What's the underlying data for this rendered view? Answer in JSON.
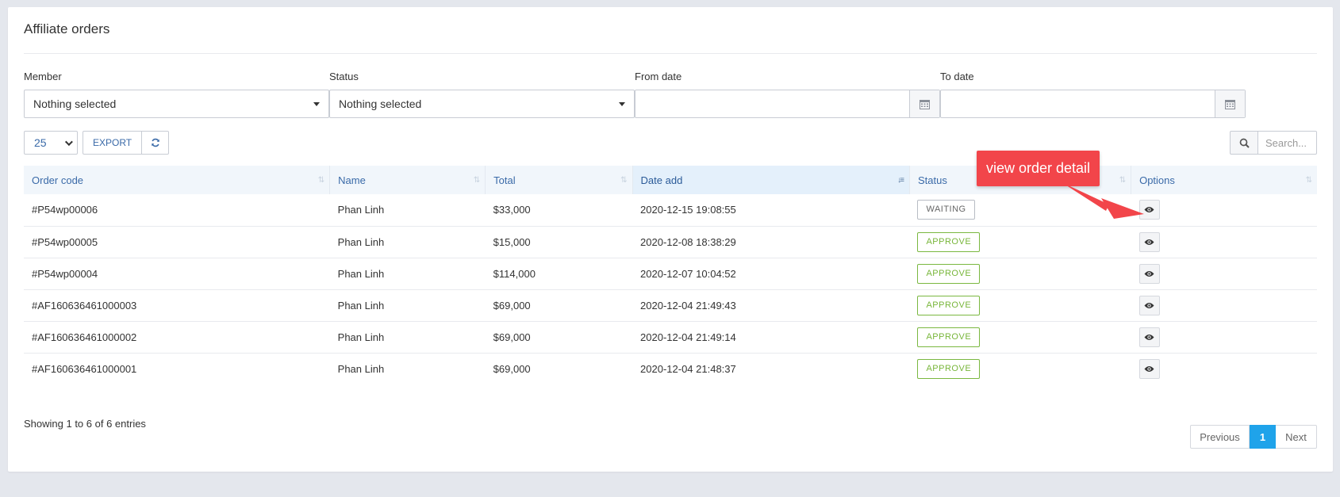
{
  "page": {
    "title": "Affiliate orders"
  },
  "filters": {
    "member": {
      "label": "Member",
      "value": "Nothing selected"
    },
    "status": {
      "label": "Status",
      "value": "Nothing selected"
    },
    "from_date": {
      "label": "From date",
      "value": ""
    },
    "to_date": {
      "label": "To date",
      "value": ""
    }
  },
  "toolbar": {
    "page_length": "25",
    "export_label": "EXPORT"
  },
  "search": {
    "placeholder": "Search..."
  },
  "table": {
    "columns": [
      "Order code",
      "Name",
      "Total",
      "Date add",
      "Status",
      "Options"
    ],
    "rows": [
      {
        "code": "#P54wp00006",
        "name": "Phan Linh",
        "total": "$33,000",
        "date": "2020-12-15 19:08:55",
        "status": "WAITING"
      },
      {
        "code": "#P54wp00005",
        "name": "Phan Linh",
        "total": "$15,000",
        "date": "2020-12-08 18:38:29",
        "status": "APPROVE"
      },
      {
        "code": "#P54wp00004",
        "name": "Phan Linh",
        "total": "$114,000",
        "date": "2020-12-07 10:04:52",
        "status": "APPROVE"
      },
      {
        "code": "#AF160636461000003",
        "name": "Phan Linh",
        "total": "$69,000",
        "date": "2020-12-04 21:49:43",
        "status": "APPROVE"
      },
      {
        "code": "#AF160636461000002",
        "name": "Phan Linh",
        "total": "$69,000",
        "date": "2020-12-04 21:49:14",
        "status": "APPROVE"
      },
      {
        "code": "#AF160636461000001",
        "name": "Phan Linh",
        "total": "$69,000",
        "date": "2020-12-04 21:48:37",
        "status": "APPROVE"
      }
    ]
  },
  "info": "Showing 1 to 6 of 6 entries",
  "pagination": {
    "previous": "Previous",
    "current": "1",
    "next": "Next"
  },
  "annotation": {
    "text": "view order detail"
  },
  "colors": {
    "accent": "#1fa3ea",
    "approve": "#7ab840",
    "callout": "#f2454a",
    "header_text": "#3a6aa8"
  },
  "icons": [
    "calendar-icon",
    "chevron-down-icon",
    "refresh-icon",
    "search-icon",
    "sort-icon",
    "eye-icon"
  ]
}
